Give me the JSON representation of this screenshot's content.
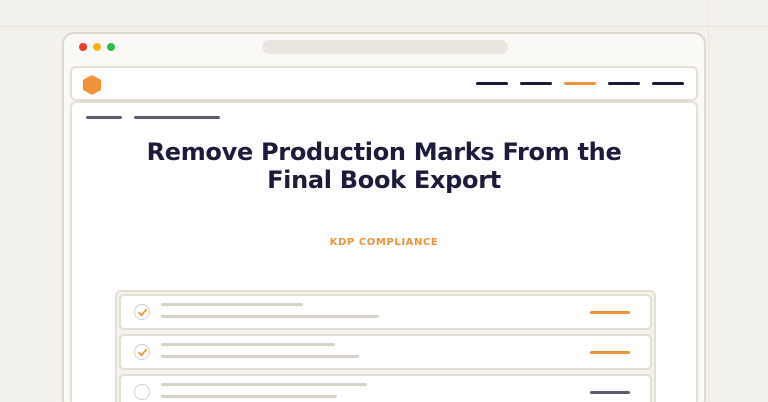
{
  "colors": {
    "accent": "#f0923a",
    "navy": "#1d1b3a",
    "muted": "#5f5a6e",
    "red_dot": "#ef3a2f",
    "yellow_dot": "#f3b41b",
    "green_dot": "#2dbd4a"
  },
  "icons": {
    "logo": "hexagon-logo-icon",
    "check": "check-icon"
  },
  "navbar": {
    "items": [
      {
        "state": "default"
      },
      {
        "state": "default"
      },
      {
        "state": "active"
      },
      {
        "state": "default"
      },
      {
        "state": "default"
      }
    ]
  },
  "page": {
    "title": "Remove Production Marks From the Final Book Export",
    "subtitle": "KDP COMPLIANCE"
  },
  "checklist": [
    {
      "checked": true,
      "status": "accent"
    },
    {
      "checked": true,
      "status": "accent"
    },
    {
      "checked": false,
      "status": "muted"
    }
  ]
}
